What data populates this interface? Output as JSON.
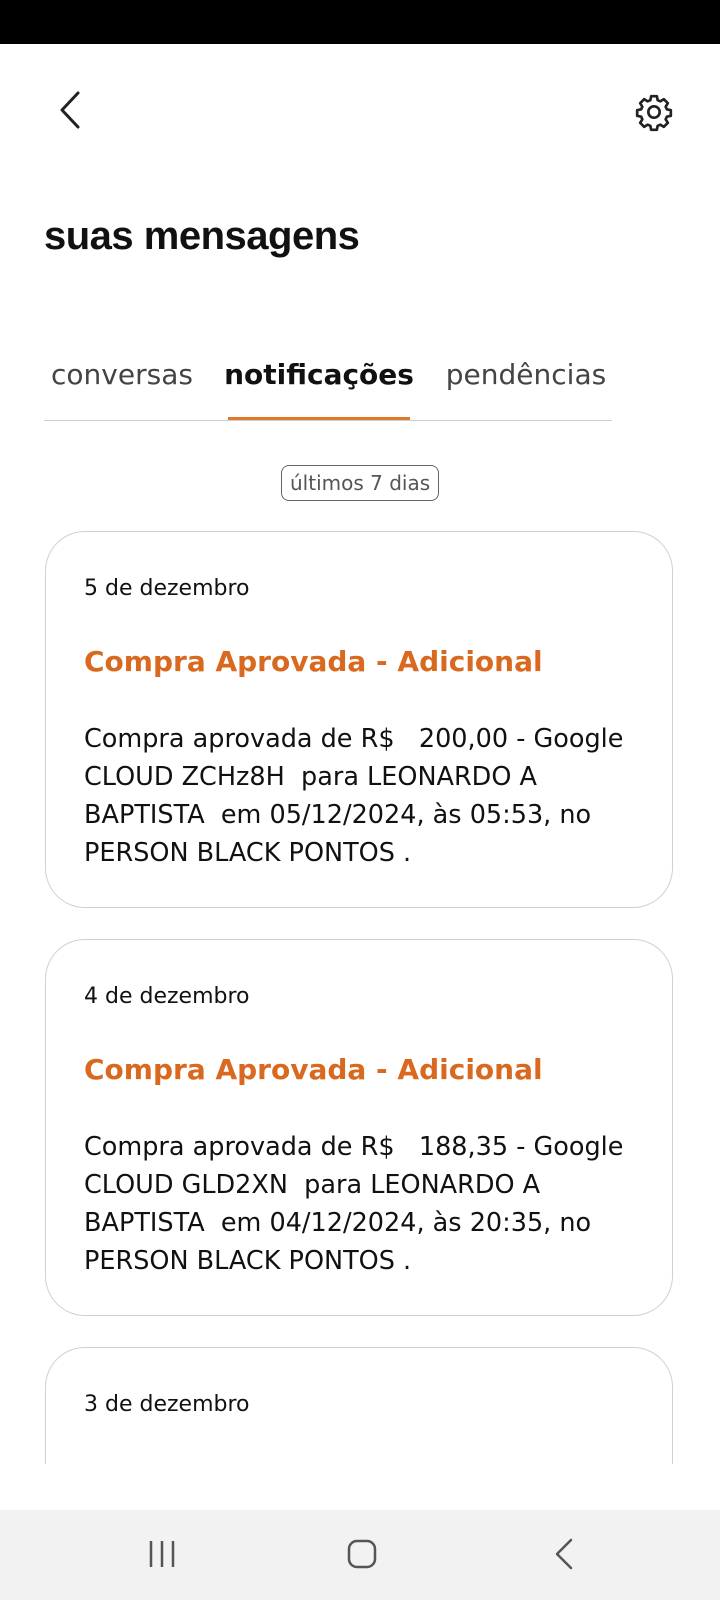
{
  "header": {
    "back_icon": "chevron-left-icon",
    "settings_icon": "gear-icon",
    "title": "suas mensagens"
  },
  "tabs": [
    {
      "label": "conversas",
      "active": false
    },
    {
      "label": "notificações",
      "active": true
    },
    {
      "label": "pendências",
      "active": false
    }
  ],
  "filter": {
    "label": "últimos 7 dias"
  },
  "notifications": [
    {
      "date": "5 de dezembro",
      "title": "Compra Aprovada - Adicional",
      "body": "Compra aprovada de R$   200,00 - Google CLOUD ZCHz8H  para LEONARDO A BAPTISTA  em 05/12/2024, às 05:53, no PERSON BLACK PONTOS ."
    },
    {
      "date": "4 de dezembro",
      "title": "Compra Aprovada - Adicional",
      "body": "Compra aprovada de R$   188,35 - Google CLOUD GLD2XN  para LEONARDO A BAPTISTA  em 04/12/2024, às 20:35, no PERSON BLACK PONTOS ."
    },
    {
      "date": "3 de dezembro"
    }
  ],
  "colors": {
    "accent": "#e07a2a",
    "title_orange": "#d9691f",
    "status_bar": "#000000",
    "nav_bar": "#f2f2f2"
  },
  "system_nav": {
    "recents_icon": "recent-apps-icon",
    "home_icon": "home-icon",
    "back_icon": "back-icon"
  }
}
